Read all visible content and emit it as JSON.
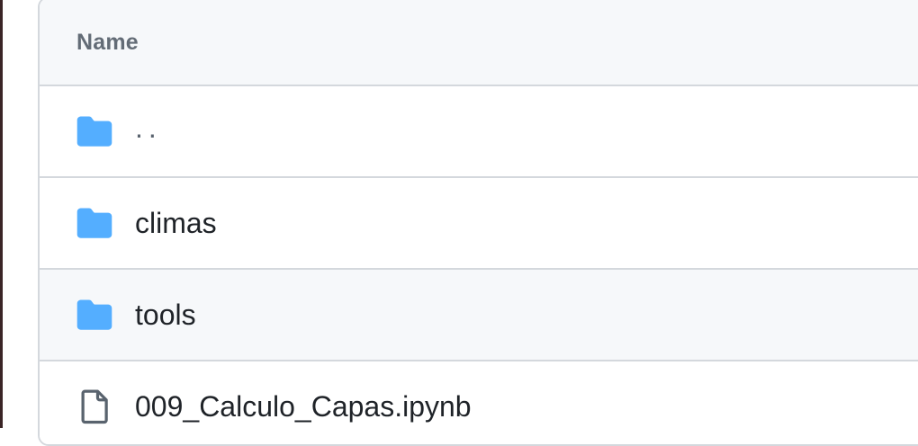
{
  "table": {
    "header": {
      "name_label": "Name"
    },
    "rows": [
      {
        "name": "..",
        "type": "folder",
        "icon": "folder-icon"
      },
      {
        "name": "climas",
        "type": "folder",
        "icon": "folder-icon"
      },
      {
        "name": "tools",
        "type": "folder",
        "icon": "folder-icon"
      },
      {
        "name": "009_Calculo_Capas.ipynb",
        "type": "file",
        "icon": "file-icon"
      }
    ]
  },
  "colors": {
    "folder": "#54aeff",
    "file_icon": "#59636e",
    "header_bg": "#f6f8fa",
    "border": "#d4d8dd",
    "text": "#1f2328",
    "header_text": "#636c76"
  }
}
